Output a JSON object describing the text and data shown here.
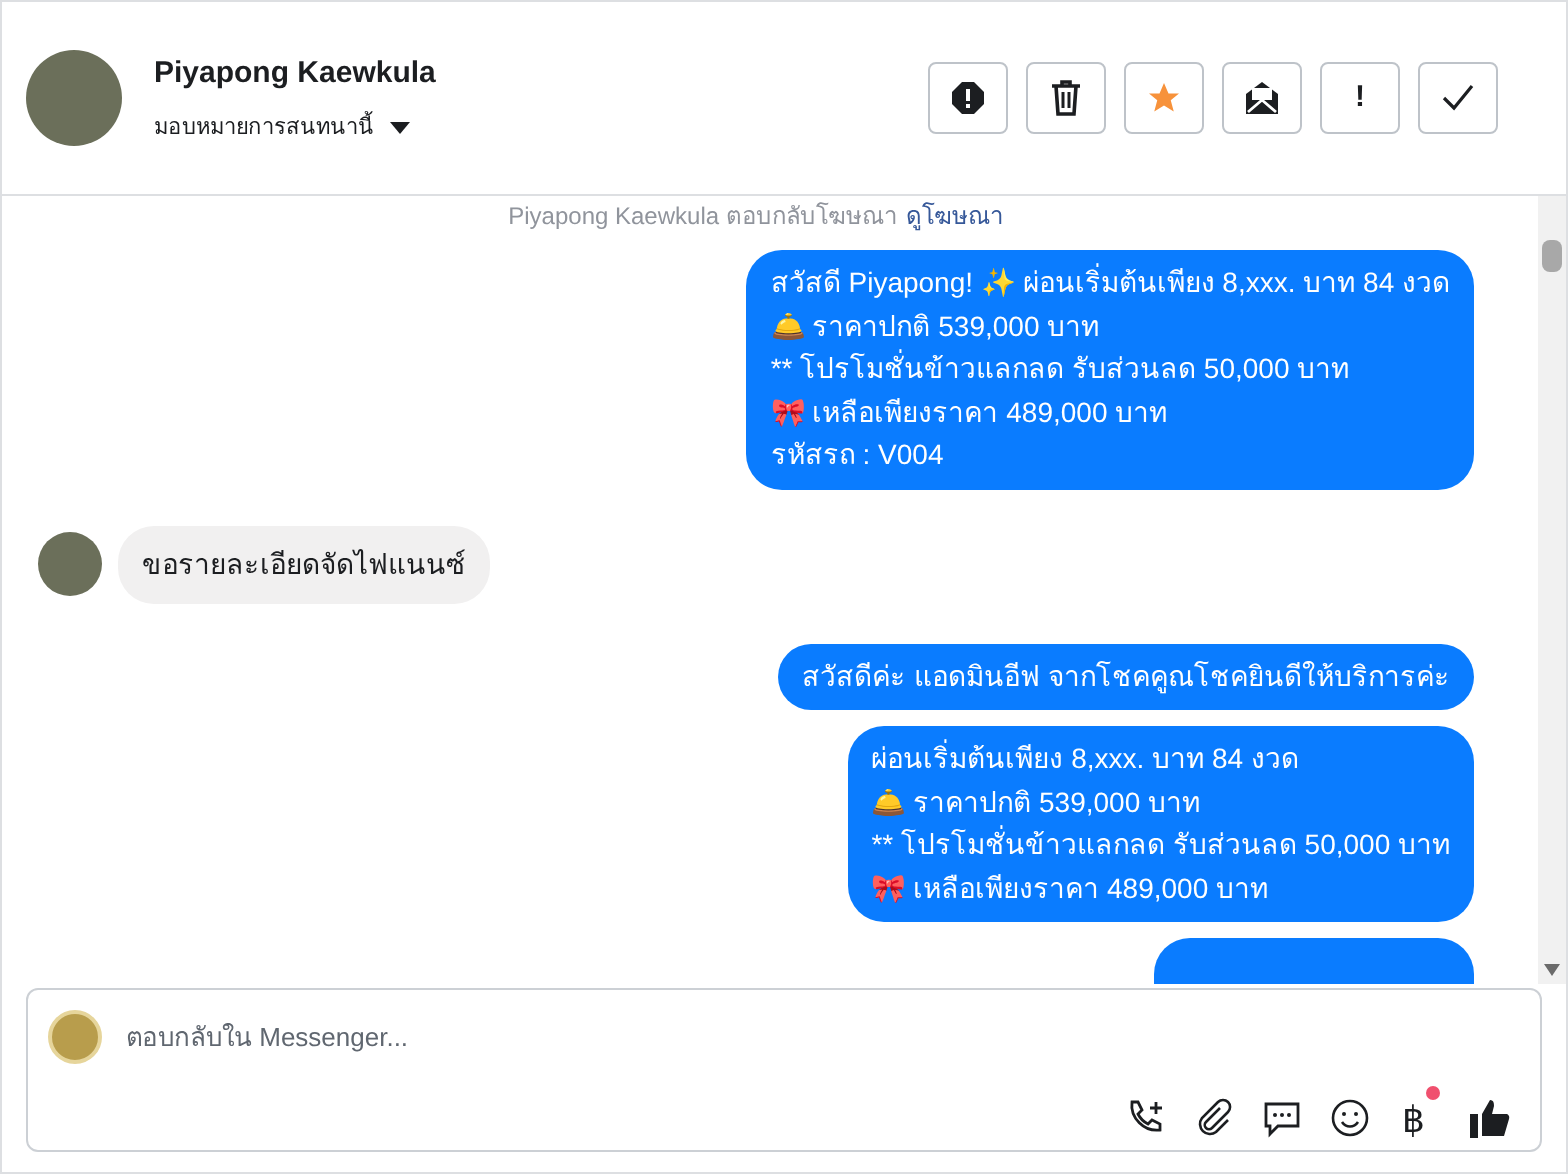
{
  "header": {
    "name": "Piyapong Kaewkula",
    "assign_label": "มอบหมายการสนทนานี้",
    "actions": [
      {
        "kind": "spam"
      },
      {
        "kind": "delete"
      },
      {
        "kind": "star",
        "on": true
      },
      {
        "kind": "unread"
      },
      {
        "kind": "text",
        "label": "!"
      },
      {
        "kind": "done"
      }
    ]
  },
  "notice": {
    "text": "Piyapong Kaewkula ตอบกลับโฆษณา",
    "link": "ดูโฆษณา"
  },
  "messages": [
    {
      "kind": "outgoing",
      "text": "สวัสดี Piyapong! ✨  ผ่อนเริ่มต้นเพียง 8,xxx. บาท 84 งวด\n🛎️ ราคาปกติ 539,000 บาท\n** โปรโมชั่นข้าวแลกลด รับส่วนลด 50,000 บาท\n🎀  เหลือเพียงราคา 489,000 บาท\n รหัสรถ : V004"
    },
    {
      "kind": "incoming",
      "text": "ขอรายละเอียดจัดไฟแนนซ์"
    },
    {
      "kind": "outgoing",
      "text": "สวัสดีค่ะ แอดมินอีฟ จากโชคคูณโชคยินดีให้บริการค่ะ"
    },
    {
      "kind": "outgoing",
      "text": "ผ่อนเริ่มต้นเพียง 8,xxx. บาท 84 งวด\n🛎️ ราคาปกติ 539,000 บาท\n** โปรโมชั่นข้าวแลกลด รับส่วนลด 50,000 บาท\n🎀  เหลือเพียงราคา 489,000 บาท"
    },
    {
      "kind": "cut"
    }
  ],
  "composer": {
    "placeholder": "ตอบกลับใน Messenger...",
    "tools": [
      {
        "kind": "call"
      },
      {
        "kind": "attach"
      },
      {
        "kind": "saved-reply"
      },
      {
        "kind": "emoji"
      },
      {
        "kind": "text",
        "label": "฿",
        "badge": true
      },
      {
        "kind": "like"
      }
    ]
  }
}
